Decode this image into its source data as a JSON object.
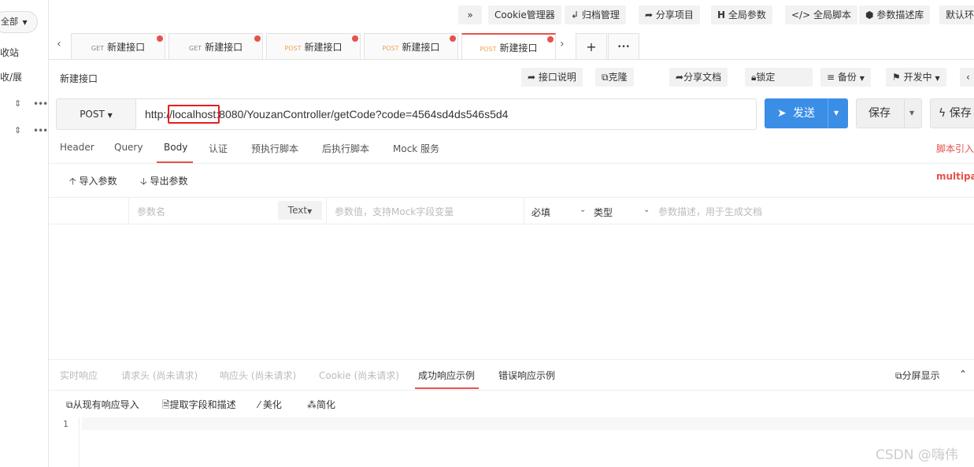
{
  "sidebar": {
    "filter": "全部",
    "recycle": "收站",
    "collapse": "收/展"
  },
  "toolbar": {
    "more": "»",
    "cookie": "Cookie管理器",
    "archive": "归档管理",
    "share_project": "分享项目",
    "global_params": "全局参数",
    "global_script": "全局脚本",
    "param_desc_lib": "参数描述库",
    "default_env": "默认环"
  },
  "tabs": [
    {
      "method": "GET",
      "name": "新建接口"
    },
    {
      "method": "GET",
      "name": "新建接口"
    },
    {
      "method": "POST",
      "name": "新建接口"
    },
    {
      "method": "POST",
      "name": "新建接口"
    },
    {
      "method": "POST",
      "name": "新建接口"
    }
  ],
  "tab_add": "+",
  "tab_more": "•••",
  "api": {
    "title": "新建接口",
    "doc": "接口说明",
    "clone": "克隆",
    "share_doc": "分享文档",
    "lock": "锁定",
    "backup": "备份",
    "status": "开发中"
  },
  "request": {
    "method": "POST",
    "url": "http://localhost:8080/YouzanController/getCode?code=4564sd4ds546s5d4",
    "send": "发送",
    "save": "保存",
    "save2": "保存"
  },
  "subtabs": {
    "header": "Header",
    "query": "Query",
    "body": "Body",
    "auth": "认证",
    "pre_script": "预执行脚本",
    "post_script": "后执行脚本",
    "mock": "Mock 服务",
    "script_import": "脚本引入"
  },
  "body": {
    "import": "导入参数",
    "export": "导出参数",
    "content_type": "multipar",
    "param_name_ph": "参数名",
    "type_select": "Text",
    "param_value_ph": "参数值，支持Mock字段变量",
    "required": "必填",
    "type": "类型",
    "desc_ph": "参数描述，用于生成文档"
  },
  "response": {
    "realtime": "实时响应",
    "req_header": "请求头 (尚未请求)",
    "resp_header": "响应头 (尚未请求)",
    "cookie": "Cookie (尚未请求)",
    "success_example": "成功响应示例",
    "error_example": "错误响应示例",
    "split": "分屏显示",
    "import_existing": "从现有响应导入",
    "extract": "提取字段和描述",
    "beautify": "美化",
    "simplify": "简化",
    "line1": "1"
  },
  "watermark": "CSDN @嗨伟",
  "colors": {
    "accent": "#e5534b",
    "primary": "#3a8ee6",
    "post": "#f0a050"
  }
}
